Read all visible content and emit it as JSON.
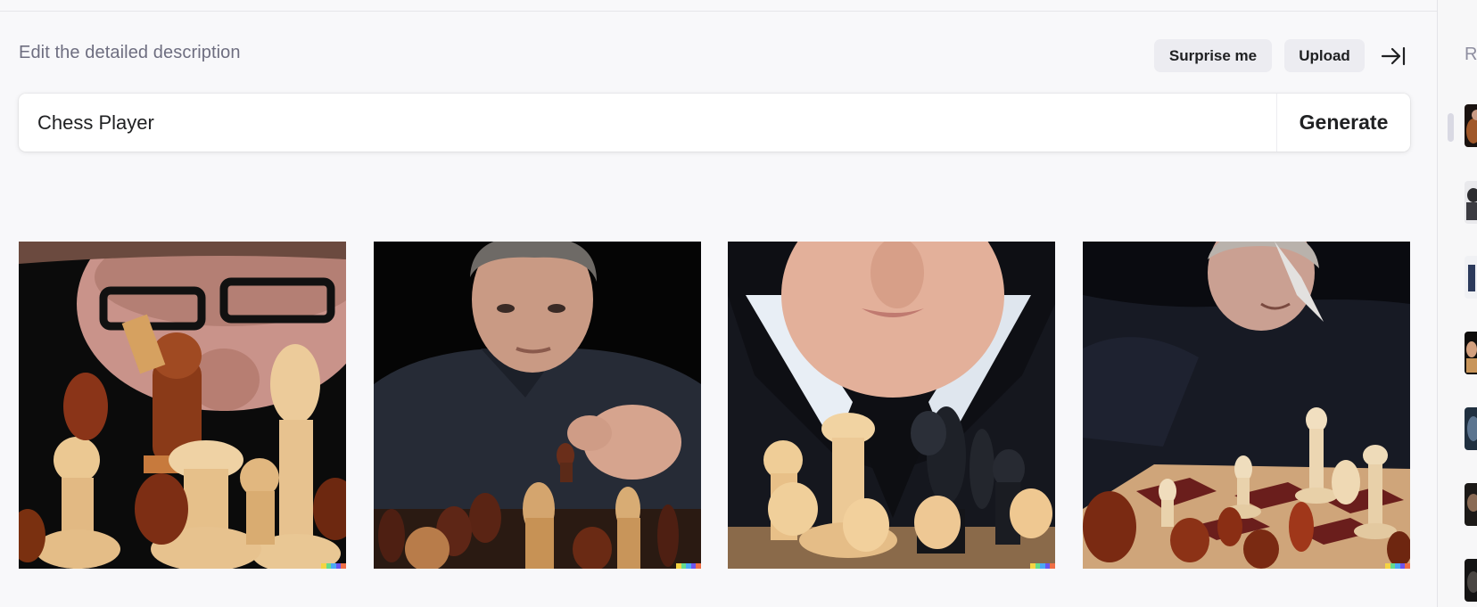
{
  "prompt": {
    "label": "Edit the detailed description",
    "value": "Chess Player",
    "generate_label": "Generate"
  },
  "toolbar": {
    "surprise_label": "Surprise me",
    "upload_label": "Upload"
  },
  "results": [
    {
      "icon": "chess-player-glasses-image"
    },
    {
      "icon": "chess-player-man-moving-piece-image"
    },
    {
      "icon": "chess-player-young-man-closeup-image"
    },
    {
      "icon": "chess-player-older-man-board-image"
    }
  ],
  "sidebar": {
    "title": "Recent",
    "thumbnails": 7
  },
  "colors": {
    "background": "#f8f8fa",
    "button_bg": "#ececf1",
    "text_primary": "#202123",
    "text_muted": "#6e6e80",
    "watermark": [
      "#f5d442",
      "#64dc8c",
      "#4aa9f5",
      "#6a55f0",
      "#ef6f46"
    ]
  }
}
